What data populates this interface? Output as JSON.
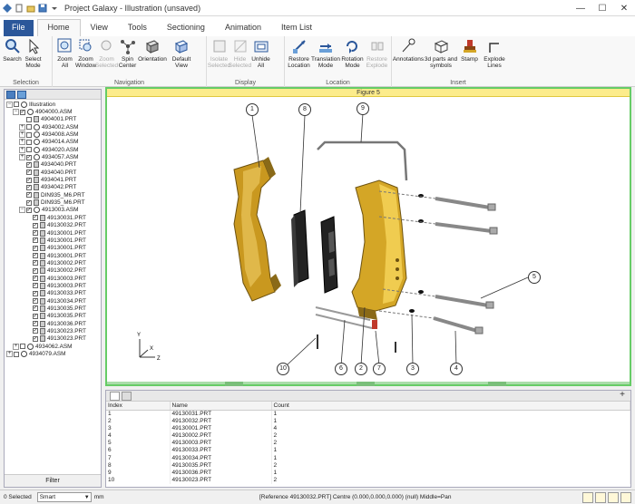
{
  "window": {
    "title": "Project Galaxy - Illustration (unsaved)",
    "minimize": "—",
    "maximize": "☐",
    "close": "✕"
  },
  "tabs": [
    {
      "label": "File"
    },
    {
      "label": "Home"
    },
    {
      "label": "View"
    },
    {
      "label": "Tools"
    },
    {
      "label": "Sectioning"
    },
    {
      "label": "Animation"
    },
    {
      "label": "Item List"
    }
  ],
  "ribbon": {
    "selection": {
      "label": "Selection",
      "search": "Search",
      "select_mode": "Select Mode"
    },
    "navigation": {
      "label": "Navigation",
      "zoom_all": "Zoom All",
      "zoom_window": "Zoom Window",
      "zoom_selected": "Zoom Selected",
      "spin_center": "Spin Center",
      "orientation": "Orientation",
      "default_view": "Default View"
    },
    "display": {
      "label": "Display",
      "isolate": "Isolate Selected",
      "hide": "Hide Selected",
      "unhide": "Unhide All"
    },
    "location": {
      "label": "Location",
      "restore": "Restore Location",
      "translation": "Translation Mode",
      "rotation": "Rotation Mode",
      "restore_explode": "Restore Explode"
    },
    "insert": {
      "label": "Insert",
      "annotations": "Annotations",
      "parts_symbols": "3d parts and symbols",
      "stamp": "Stamp",
      "explode_lines": "Explode Lines"
    }
  },
  "tree": {
    "items": [
      {
        "label": "Illustration",
        "depth": 0,
        "exp": "−",
        "chk": "",
        "kind": "node"
      },
      {
        "label": "4904000.ASM",
        "depth": 1,
        "exp": "−",
        "chk": "✓",
        "kind": "node"
      },
      {
        "label": "4904001.PRT",
        "depth": 2,
        "exp": "",
        "chk": "",
        "kind": "part"
      },
      {
        "label": "4934002.ASM",
        "depth": 2,
        "exp": "+",
        "chk": "",
        "kind": "node"
      },
      {
        "label": "4934008.ASM",
        "depth": 2,
        "exp": "+",
        "chk": "",
        "kind": "node"
      },
      {
        "label": "4934014.ASM",
        "depth": 2,
        "exp": "+",
        "chk": "",
        "kind": "node"
      },
      {
        "label": "4934020.ASM",
        "depth": 2,
        "exp": "+",
        "chk": "",
        "kind": "node"
      },
      {
        "label": "4934057.ASM",
        "depth": 2,
        "exp": "+",
        "chk": "✓",
        "kind": "node"
      },
      {
        "label": "4934040.PRT",
        "depth": 2,
        "exp": "",
        "chk": "✓",
        "kind": "part"
      },
      {
        "label": "4934040.PRT",
        "depth": 2,
        "exp": "",
        "chk": "✓",
        "kind": "part"
      },
      {
        "label": "4934041.PRT",
        "depth": 2,
        "exp": "",
        "chk": "✓",
        "kind": "part"
      },
      {
        "label": "4934042.PRT",
        "depth": 2,
        "exp": "",
        "chk": "✓",
        "kind": "part"
      },
      {
        "label": "DIN935_M6.PRT",
        "depth": 2,
        "exp": "",
        "chk": "✓",
        "kind": "part"
      },
      {
        "label": "DIN935_M6.PRT",
        "depth": 2,
        "exp": "",
        "chk": "✓",
        "kind": "part"
      },
      {
        "label": "4913003.ASM",
        "depth": 2,
        "exp": "−",
        "chk": "✓",
        "kind": "node"
      },
      {
        "label": "49130031.PRT",
        "depth": 3,
        "exp": "",
        "chk": "✓",
        "kind": "part"
      },
      {
        "label": "49130032.PRT",
        "depth": 3,
        "exp": "",
        "chk": "✓",
        "kind": "part"
      },
      {
        "label": "49130001.PRT",
        "depth": 3,
        "exp": "",
        "chk": "✓",
        "kind": "part"
      },
      {
        "label": "49130001.PRT",
        "depth": 3,
        "exp": "",
        "chk": "✓",
        "kind": "part"
      },
      {
        "label": "49130001.PRT",
        "depth": 3,
        "exp": "",
        "chk": "✓",
        "kind": "part"
      },
      {
        "label": "49130001.PRT",
        "depth": 3,
        "exp": "",
        "chk": "✓",
        "kind": "part"
      },
      {
        "label": "49130002.PRT",
        "depth": 3,
        "exp": "",
        "chk": "✓",
        "kind": "part"
      },
      {
        "label": "49130002.PRT",
        "depth": 3,
        "exp": "",
        "chk": "✓",
        "kind": "part"
      },
      {
        "label": "49130003.PRT",
        "depth": 3,
        "exp": "",
        "chk": "✓",
        "kind": "part"
      },
      {
        "label": "49130003.PRT",
        "depth": 3,
        "exp": "",
        "chk": "✓",
        "kind": "part"
      },
      {
        "label": "49130033.PRT",
        "depth": 3,
        "exp": "",
        "chk": "✓",
        "kind": "part"
      },
      {
        "label": "49130034.PRT",
        "depth": 3,
        "exp": "",
        "chk": "✓",
        "kind": "part"
      },
      {
        "label": "49130035.PRT",
        "depth": 3,
        "exp": "",
        "chk": "✓",
        "kind": "part"
      },
      {
        "label": "49130035.PRT",
        "depth": 3,
        "exp": "",
        "chk": "✓",
        "kind": "part"
      },
      {
        "label": "49130036.PRT",
        "depth": 3,
        "exp": "",
        "chk": "✓",
        "kind": "part"
      },
      {
        "label": "49130023.PRT",
        "depth": 3,
        "exp": "",
        "chk": "✓",
        "kind": "part"
      },
      {
        "label": "49130023.PRT",
        "depth": 3,
        "exp": "",
        "chk": "✓",
        "kind": "part"
      },
      {
        "label": "4934062.ASM",
        "depth": 1,
        "exp": "+",
        "chk": "",
        "kind": "node"
      },
      {
        "label": "4934079.ASM",
        "depth": 0,
        "exp": "+",
        "chk": "",
        "kind": "node"
      }
    ],
    "filter": "Filter"
  },
  "viewport": {
    "figure_title": "Figure 5"
  },
  "callouts": [
    "1",
    "8",
    "9",
    "5",
    "10",
    "6",
    "2",
    "7",
    "3",
    "4"
  ],
  "axis": {
    "y": "Y",
    "x": "X",
    "z": "Z"
  },
  "table": {
    "headers": [
      "Index",
      "Name",
      "Count"
    ],
    "rows": [
      [
        "1",
        "49130031.PRT",
        "1"
      ],
      [
        "2",
        "49130032.PRT",
        "1"
      ],
      [
        "3",
        "49130001.PRT",
        "4"
      ],
      [
        "4",
        "49130002.PRT",
        "2"
      ],
      [
        "5",
        "49130003.PRT",
        "2"
      ],
      [
        "6",
        "49130033.PRT",
        "1"
      ],
      [
        "7",
        "49130034.PRT",
        "1"
      ],
      [
        "8",
        "49130035.PRT",
        "2"
      ],
      [
        "9",
        "49130036.PRT",
        "1"
      ],
      [
        "10",
        "49130023.PRT",
        "2"
      ]
    ],
    "add": "+"
  },
  "status": {
    "selected": "0 Selected",
    "mode": "Smart",
    "unit": "mm",
    "message": "[Reference 49130032.PRT] Centre (0.000,0.000,0.000) (null)  Middle=Pan"
  },
  "colors": {
    "accent": "#2b579a",
    "viewport_border": "#66cc66",
    "figure_header": "#fcec8c",
    "caliper_gold": "#d4a626"
  }
}
